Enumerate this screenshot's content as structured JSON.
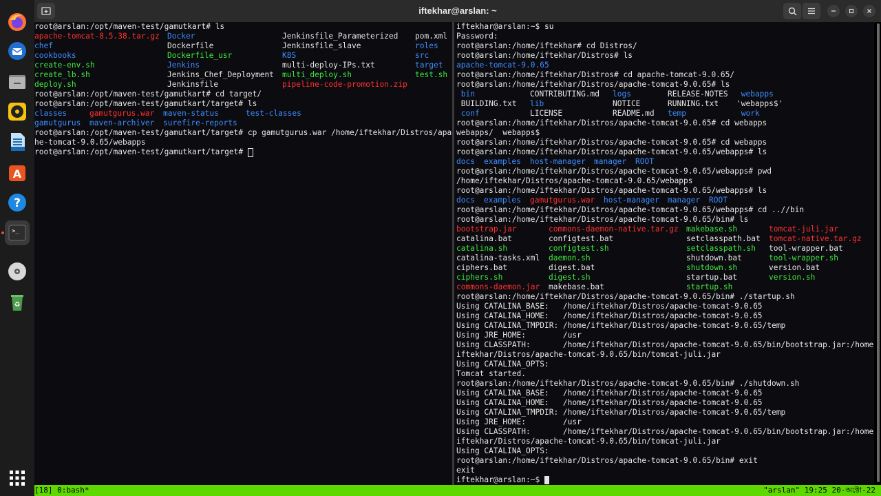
{
  "window": {
    "title": "iftekhar@arslan: ~"
  },
  "dock": {
    "items": [
      {
        "name": "firefox",
        "icon": "firefox-icon"
      },
      {
        "name": "thunderbird",
        "icon": "thunderbird-icon"
      },
      {
        "name": "files",
        "icon": "files-icon"
      },
      {
        "name": "rhythmbox",
        "icon": "rhythmbox-icon"
      },
      {
        "name": "libreoffice-writer",
        "icon": "writer-icon"
      },
      {
        "name": "app-center",
        "icon": "app-center-icon"
      },
      {
        "name": "help",
        "icon": "help-icon"
      },
      {
        "name": "terminal",
        "icon": "terminal-icon"
      },
      {
        "name": "disc",
        "icon": "disc-icon"
      },
      {
        "name": "trash",
        "icon": "trash-icon"
      },
      {
        "name": "show-apps",
        "icon": "app-grid-icon"
      }
    ]
  },
  "colors": {
    "terminal_bg": "#0c0c10",
    "directory": "#3d8bff",
    "archive": "#ff3030",
    "executable": "#3ee83e",
    "symlink": "#3dd6e8",
    "status_bar": "#5fd700"
  },
  "left_pane": {
    "prompt1": "root@arslan:/opt/maven-test/gamutkart# ls",
    "ls1": [
      [
        {
          "t": "apache-tomcat-8.5.38.tar.gz",
          "c": "red"
        },
        {
          "t": "Docker",
          "c": "blue"
        },
        {
          "t": "Jenkinsfile_Parameterized",
          "c": ""
        },
        {
          "t": "pom.xml",
          "c": ""
        }
      ],
      [
        {
          "t": "chef",
          "c": "blue"
        },
        {
          "t": "Dockerfile",
          "c": ""
        },
        {
          "t": "Jenkinsfile_slave",
          "c": ""
        },
        {
          "t": "roles",
          "c": "blue"
        }
      ],
      [
        {
          "t": "cookbooks",
          "c": "blue"
        },
        {
          "t": "Dockerfile_usr",
          "c": "green"
        },
        {
          "t": "K8S",
          "c": "blue"
        },
        {
          "t": "src",
          "c": "blue"
        }
      ],
      [
        {
          "t": "create-env.sh",
          "c": "green"
        },
        {
          "t": "Jenkins",
          "c": "blue"
        },
        {
          "t": "multi-deploy-IPs.txt",
          "c": ""
        },
        {
          "t": "target",
          "c": "blue"
        }
      ],
      [
        {
          "t": "create_lb.sh",
          "c": "green"
        },
        {
          "t": "Jenkins_Chef_Deployment",
          "c": ""
        },
        {
          "t": "multi_deploy.sh",
          "c": "green"
        },
        {
          "t": "test.sh",
          "c": "green"
        }
      ],
      [
        {
          "t": "deploy.sh",
          "c": "green"
        },
        {
          "t": "Jenkinsfile",
          "c": ""
        },
        {
          "t": "pipeline-code-promotion.zip",
          "c": "red"
        },
        {
          "t": "",
          "c": ""
        }
      ]
    ],
    "prompt2": "root@arslan:/opt/maven-test/gamutkart# cd target/",
    "prompt3": "root@arslan:/opt/maven-test/gamutkart/target# ls",
    "ls2": [
      [
        {
          "t": "classes",
          "c": "blue"
        },
        {
          "t": "gamutgurus.war",
          "c": "red"
        },
        {
          "t": "maven-status",
          "c": "blue"
        },
        {
          "t": "test-classes",
          "c": "blue"
        }
      ],
      [
        {
          "t": "gamutgurus",
          "c": "blue"
        },
        {
          "t": "maven-archiver",
          "c": "blue"
        },
        {
          "t": "surefire-reports",
          "c": "blue"
        },
        {
          "t": "",
          "c": ""
        }
      ]
    ],
    "prompt4": "root@arslan:/opt/maven-test/gamutkart/target# cp gamutgurus.war /home/iftekhar/Distros/apac",
    "wrap4": "he-tomcat-9.0.65/webapps",
    "prompt5": "root@arslan:/opt/maven-test/gamutkart/target# "
  },
  "right_pane": {
    "l01": "iftekhar@arslan:~$ su",
    "l02": "Password:",
    "l03": "root@arslan:/home/iftekhar# cd Distros/",
    "l04": "root@arslan:/home/iftekhar/Distros# ls",
    "l05": "apache-tomcat-9.0.65",
    "l06": "root@arslan:/home/iftekhar/Distros# cd apache-tomcat-9.0.65/",
    "l07": "root@arslan:/home/iftekhar/Distros/apache-tomcat-9.0.65# ls",
    "ls_tomcat": [
      [
        {
          "t": " bin",
          "c": "blue"
        },
        {
          "t": "CONTRIBUTING.md",
          "c": ""
        },
        {
          "t": "logs",
          "c": "blue"
        },
        {
          "t": "RELEASE-NOTES",
          "c": ""
        },
        {
          "t": " webapps",
          "c": "blue"
        }
      ],
      [
        {
          "t": " BUILDING.txt",
          "c": ""
        },
        {
          "t": "lib",
          "c": "blue"
        },
        {
          "t": "NOTICE",
          "c": ""
        },
        {
          "t": "RUNNING.txt",
          "c": ""
        },
        {
          "t": "'webapps$'",
          "c": ""
        }
      ],
      [
        {
          "t": " conf",
          "c": "blue"
        },
        {
          "t": "LICENSE",
          "c": ""
        },
        {
          "t": "README.md",
          "c": ""
        },
        {
          "t": "temp",
          "c": "blue"
        },
        {
          "t": " work",
          "c": "blue"
        }
      ]
    ],
    "l11": "root@arslan:/home/iftekhar/Distros/apache-tomcat-9.0.65# cd webapps",
    "l12": "webapps/  webapps$",
    "l13": "root@arslan:/home/iftekhar/Distros/apache-tomcat-9.0.65# cd webapps",
    "l14": "root@arslan:/home/iftekhar/Distros/apache-tomcat-9.0.65/webapps# ls",
    "ls_webapps1": [
      {
        "t": "docs",
        "c": "blue"
      },
      {
        "t": "examples",
        "c": "blue"
      },
      {
        "t": "host-manager",
        "c": "blue"
      },
      {
        "t": "manager",
        "c": "blue"
      },
      {
        "t": "ROOT",
        "c": "blue"
      }
    ],
    "l16": "root@arslan:/home/iftekhar/Distros/apache-tomcat-9.0.65/webapps# pwd",
    "l17": "/home/iftekhar/Distros/apache-tomcat-9.0.65/webapps",
    "l18": "root@arslan:/home/iftekhar/Distros/apache-tomcat-9.0.65/webapps# ls",
    "ls_webapps2": [
      {
        "t": "docs",
        "c": "blue"
      },
      {
        "t": "examples",
        "c": "blue"
      },
      {
        "t": "gamutgurus.war",
        "c": "red"
      },
      {
        "t": "host-manager",
        "c": "blue"
      },
      {
        "t": "manager",
        "c": "blue"
      },
      {
        "t": "ROOT",
        "c": "blue"
      }
    ],
    "l20": "root@arslan:/home/iftekhar/Distros/apache-tomcat-9.0.65/webapps# cd ..//bin",
    "l21": "root@arslan:/home/iftekhar/Distros/apache-tomcat-9.0.65/bin# ls",
    "ls_bin": [
      [
        {
          "t": "bootstrap.jar",
          "c": "red"
        },
        {
          "t": "commons-daemon-native.tar.gz",
          "c": "red"
        },
        {
          "t": "makebase.sh",
          "c": "green"
        },
        {
          "t": "tomcat-juli.jar",
          "c": "red"
        }
      ],
      [
        {
          "t": "catalina.bat",
          "c": ""
        },
        {
          "t": "configtest.bat",
          "c": ""
        },
        {
          "t": "setclasspath.bat",
          "c": ""
        },
        {
          "t": "tomcat-native.tar.gz",
          "c": "red"
        }
      ],
      [
        {
          "t": "catalina.sh",
          "c": "green"
        },
        {
          "t": "configtest.sh",
          "c": "green"
        },
        {
          "t": "setclasspath.sh",
          "c": "green"
        },
        {
          "t": "tool-wrapper.bat",
          "c": ""
        }
      ],
      [
        {
          "t": "catalina-tasks.xml",
          "c": ""
        },
        {
          "t": "daemon.sh",
          "c": "green"
        },
        {
          "t": "shutdown.bat",
          "c": ""
        },
        {
          "t": "tool-wrapper.sh",
          "c": "green"
        }
      ],
      [
        {
          "t": "ciphers.bat",
          "c": ""
        },
        {
          "t": "digest.bat",
          "c": ""
        },
        {
          "t": "shutdown.sh",
          "c": "green"
        },
        {
          "t": "version.bat",
          "c": ""
        }
      ],
      [
        {
          "t": "ciphers.sh",
          "c": "green"
        },
        {
          "t": "digest.sh",
          "c": "green"
        },
        {
          "t": "startup.bat",
          "c": ""
        },
        {
          "t": "version.sh",
          "c": "green"
        }
      ],
      [
        {
          "t": "commons-daemon.jar",
          "c": "red"
        },
        {
          "t": "makebase.bat",
          "c": ""
        },
        {
          "t": "startup.sh",
          "c": "green"
        },
        {
          "t": "",
          "c": ""
        }
      ]
    ],
    "l29": "root@arslan:/home/iftekhar/Distros/apache-tomcat-9.0.65/bin# ./startup.sh",
    "l30": "Using CATALINA_BASE:   /home/iftekhar/Distros/apache-tomcat-9.0.65",
    "l31": "Using CATALINA_HOME:   /home/iftekhar/Distros/apache-tomcat-9.0.65",
    "l32": "Using CATALINA_TMPDIR: /home/iftekhar/Distros/apache-tomcat-9.0.65/temp",
    "l33": "Using JRE_HOME:        /usr",
    "l34": "Using CLASSPATH:       /home/iftekhar/Distros/apache-tomcat-9.0.65/bin/bootstrap.jar:/home/",
    "l35": "iftekhar/Distros/apache-tomcat-9.0.65/bin/tomcat-juli.jar",
    "l36": "Using CATALINA_OPTS:",
    "l37": "Tomcat started.",
    "l38": "root@arslan:/home/iftekhar/Distros/apache-tomcat-9.0.65/bin# ./shutdown.sh",
    "l39": "Using CATALINA_BASE:   /home/iftekhar/Distros/apache-tomcat-9.0.65",
    "l40": "Using CATALINA_HOME:   /home/iftekhar/Distros/apache-tomcat-9.0.65",
    "l41": "Using CATALINA_TMPDIR: /home/iftekhar/Distros/apache-tomcat-9.0.65/temp",
    "l42": "Using JRE_HOME:        /usr",
    "l43": "Using CLASSPATH:       /home/iftekhar/Distros/apache-tomcat-9.0.65/bin/bootstrap.jar:/home/",
    "l44": "iftekhar/Distros/apache-tomcat-9.0.65/bin/tomcat-juli.jar",
    "l45": "Using CATALINA_OPTS:",
    "l46": "root@arslan:/home/iftekhar/Distros/apache-tomcat-9.0.65/bin# exit",
    "l47": "exit",
    "l48": "iftekhar@arslan:~$ "
  },
  "statusbar": {
    "left": "[18] 0:bash*",
    "right": "\"arslan\" 19:25 20-অক্টো-22"
  }
}
